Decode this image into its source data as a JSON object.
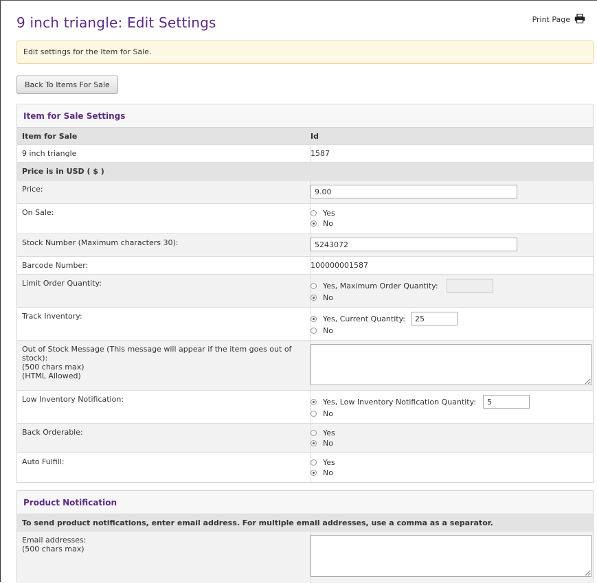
{
  "page": {
    "title": "9 inch triangle: Edit Settings",
    "print_label": "Print Page",
    "alert": "Edit settings for the Item for Sale.",
    "back_button": "Back To Items For Sale"
  },
  "settings": {
    "title": "Item for Sale Settings",
    "col_item": "Item for Sale",
    "col_id": "Id",
    "item_name": "9 inch triangle",
    "item_id": "1587",
    "price_note": "Price is in USD ( $ )",
    "price_label": "Price:",
    "price_value": "9.00",
    "on_sale_label": "On Sale:",
    "yes": "Yes",
    "no": "No",
    "stock_label": "Stock Number (Maximum characters 30):",
    "stock_value": "5243072",
    "barcode_label": "Barcode Number:",
    "barcode_value": "100000001587",
    "limit_label": "Limit Order Quantity:",
    "limit_yes": "Yes, Maximum Order Quantity:",
    "limit_value": "",
    "track_label": "Track Inventory:",
    "track_yes": "Yes, Current Quantity:",
    "track_value": "25",
    "oos_label_1": "Out of Stock Message (This message will appear if the item goes out of stock):",
    "oos_label_2": "(500 chars max)",
    "oos_label_3": "(HTML Allowed)",
    "oos_value": "",
    "low_label": "Low Inventory Notification:",
    "low_yes": "Yes, Low Inventory Notification Quantity:",
    "low_value": "5",
    "back_label": "Back Orderable:",
    "auto_label": "Auto Fulfill:"
  },
  "notification": {
    "title": "Product Notification",
    "instruction": "To send product notifications, enter email address. For multiple email addresses, use a comma as a separator.",
    "email_label_1": "Email addresses:",
    "email_label_2": "(500 chars max)",
    "email_value": ""
  },
  "colors": {
    "accent": "#5b2c83",
    "alert_bg": "#fcf8e3",
    "alert_border": "#f2d39a"
  }
}
